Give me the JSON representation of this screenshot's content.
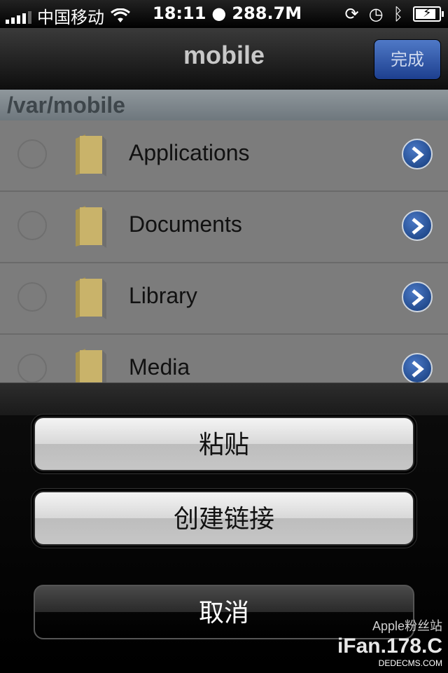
{
  "status_bar": {
    "carrier": "中国移动",
    "time": "18:11",
    "memory": "288.7M"
  },
  "nav": {
    "title": "mobile",
    "done_label": "完成"
  },
  "path": "/var/mobile",
  "files": [
    {
      "name": "Applications"
    },
    {
      "name": "Documents"
    },
    {
      "name": "Library"
    },
    {
      "name": "Media"
    }
  ],
  "action_sheet": {
    "paste_label": "粘贴",
    "create_link_label": "创建链接",
    "cancel_label": "取消"
  },
  "watermark": {
    "top": "Apple粉丝站",
    "main": "iFan.178.C",
    "small": "DEDECMS.COM"
  },
  "colors": {
    "accent_blue": "#1d3f8f",
    "folder": "#c9b36a"
  }
}
